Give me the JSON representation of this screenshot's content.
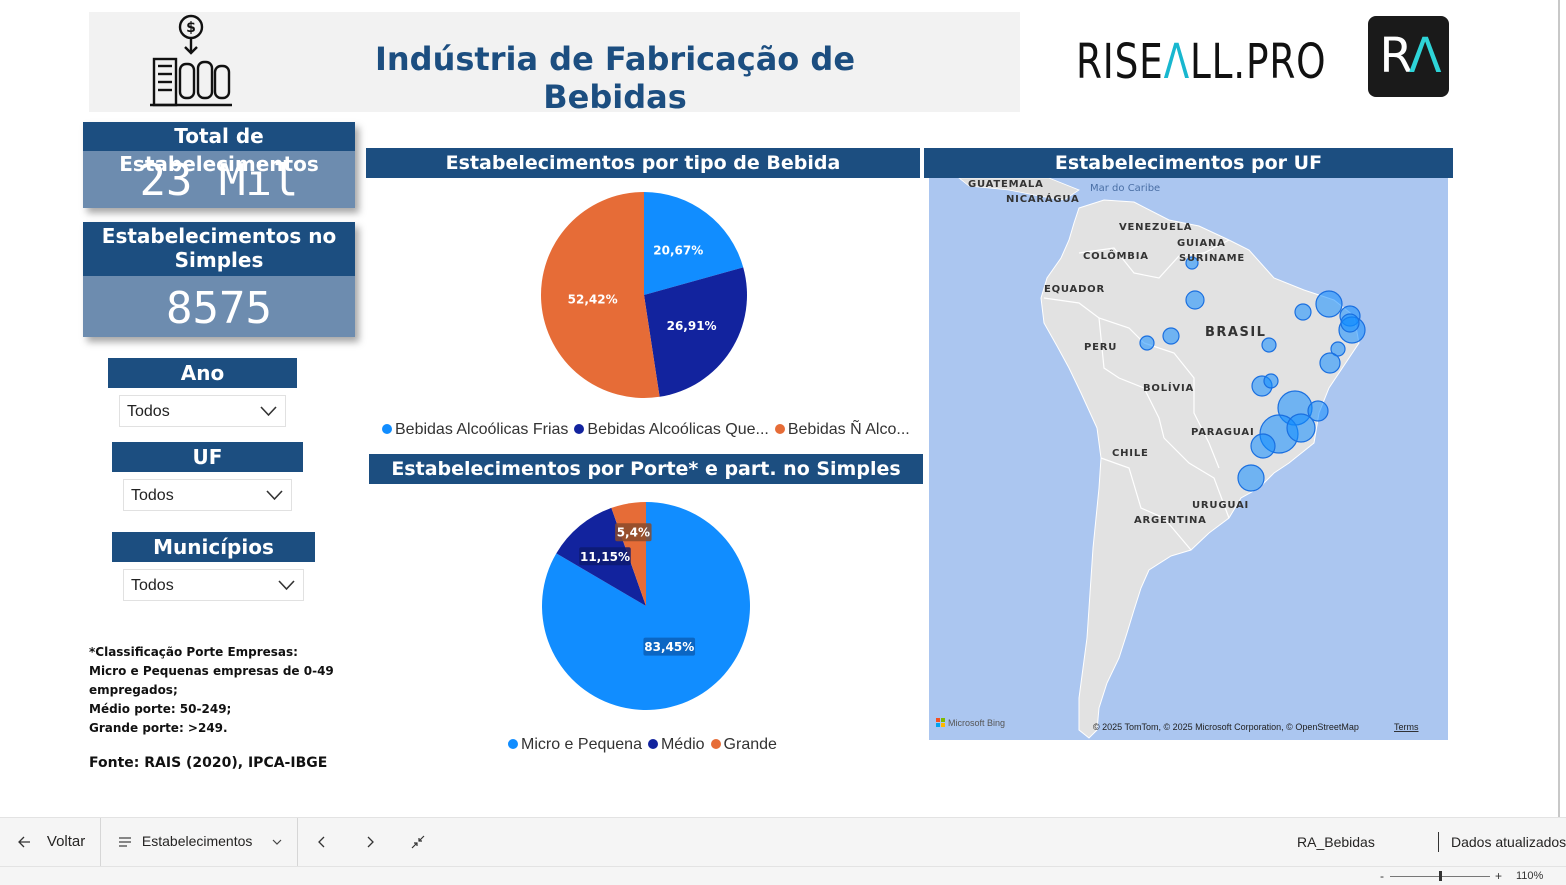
{
  "header": {
    "title": "Indústria de Fabricação de Bebidas",
    "brand_left": "RISE",
    "brand_accent": "Λ",
    "brand_right": "LL.PRO",
    "logo_left": "R",
    "logo_accent": "Λ",
    "icon": "factory-dollar-icon"
  },
  "kpis": {
    "total_label": "Total de Estabelecimentos",
    "total_value": "23 Mil",
    "simples_label_1": "Estabelecimentos no",
    "simples_label_2": "Simples",
    "simples_value": "8575"
  },
  "slicers": {
    "ano_label": "Ano",
    "ano_value": "Todos",
    "uf_label": "UF",
    "uf_value": "Todos",
    "municipios_label": "Municípios",
    "municipios_value": "Todos",
    "chevron_icon": "chevron-down-icon"
  },
  "footnote": {
    "line1": "*Classificação Porte Empresas:",
    "line2": "Micro e Pequenas empresas de 0-49",
    "line3": "empregados;",
    "line4": "Médio porte: 50-249;",
    "line5": "Grande porte: >249.",
    "source": "Fonte: RAIS (2020), IPCA-IBGE"
  },
  "visuals": {
    "pie1_title": "Estabelecimentos por tipo de Bebida",
    "pie2_title": "Estabelecimentos por Porte* e part. no Simples",
    "map_title": "Estabelecimentos por UF"
  },
  "colors": {
    "navy": "#1c4e80",
    "blue": "#118dff",
    "dark_blue": "#12239e",
    "orange": "#e66c37",
    "kpi_value_bg": "#6d8caf"
  },
  "chart_data": [
    {
      "type": "pie",
      "title": "Estabelecimentos por tipo de Bebida",
      "categories": [
        "Bebidas Alcoólicas Frias",
        "Bebidas Alcoólicas Que...",
        "Bebidas Ñ Alco..."
      ],
      "values": [
        20.67,
        26.91,
        52.42
      ],
      "labels": [
        "20,67%",
        "26,91%",
        "52,42%"
      ],
      "colors": [
        "#118dff",
        "#12239e",
        "#e66c37"
      ],
      "legend": "bottom"
    },
    {
      "type": "pie",
      "title": "Estabelecimentos por Porte* e part. no Simples",
      "categories": [
        "Micro e Pequena",
        "Médio",
        "Grande"
      ],
      "values": [
        83.45,
        11.15,
        5.4
      ],
      "labels": [
        "83,45%",
        "11,15%",
        "5,4%"
      ],
      "colors": [
        "#118dff",
        "#12239e",
        "#e66c37"
      ],
      "legend": "bottom"
    }
  ],
  "map": {
    "countries": {
      "guatemala": "GUATEMALA",
      "nicaragua": "NICARÁGUA",
      "mar": "Mar do Caribe",
      "venezuela": "VENEZUELA",
      "guiana": "GUIANA",
      "colombia": "COLÔMBIA",
      "suriname": "SURINAME",
      "equador": "EQUADOR",
      "brasil": "BRASIL",
      "peru": "PERU",
      "bolivia": "BOLÍVIA",
      "paraguai": "PARAGUAI",
      "chile": "CHILE",
      "uruguai": "URUGUAI",
      "argentina": "ARGENTINA"
    },
    "attribution": "© 2025 TomTom, © 2025 Microsoft Corporation, © OpenStreetMap",
    "terms": "Terms",
    "bing": "Microsoft Bing"
  },
  "bottom_bar": {
    "back_label": "Voltar",
    "page_label": "Estabelecimentos",
    "report_name": "RA_Bebidas",
    "refresh_label": "Dados atualizados",
    "zoom": "110%",
    "zoom_minus": "-",
    "zoom_plus": "+"
  }
}
